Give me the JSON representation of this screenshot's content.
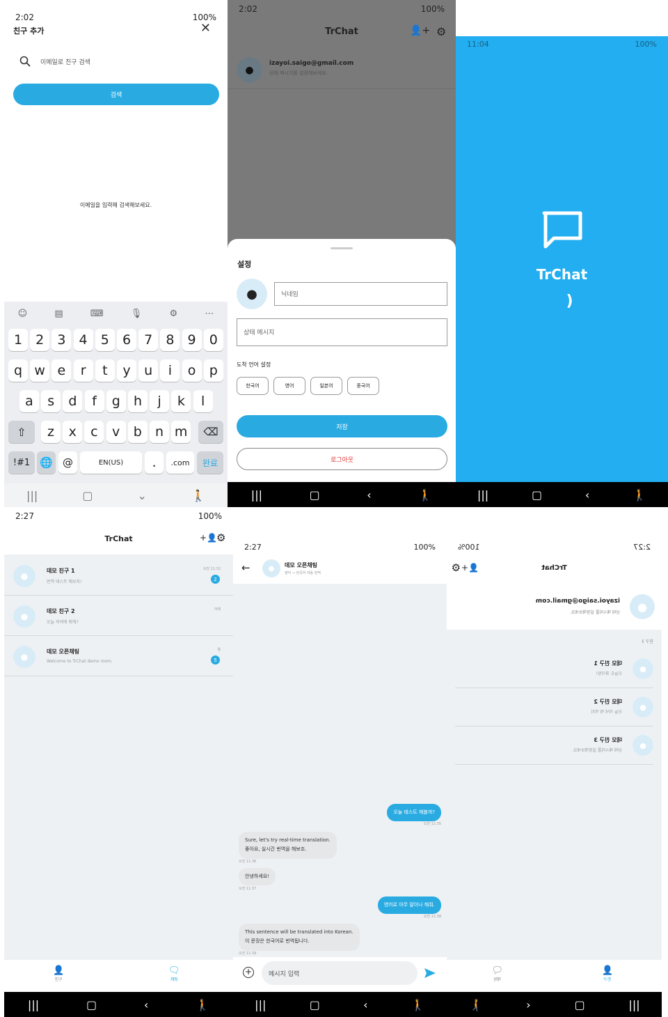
{
  "p1": {
    "time": "2:02",
    "status": "100%",
    "title": "친구 추가",
    "search_placeholder": "이메일로 친구 검색",
    "search_button": "검색",
    "hint": "이메일을 입력해 검색해보세요.",
    "row1": [
      "1",
      "2",
      "3",
      "4",
      "5",
      "6",
      "7",
      "8",
      "9",
      "0"
    ],
    "row2": [
      "q",
      "w",
      "e",
      "r",
      "t",
      "y",
      "u",
      "i",
      "o",
      "p"
    ],
    "row3": [
      "a",
      "s",
      "d",
      "f",
      "g",
      "h",
      "j",
      "k",
      "l"
    ],
    "row4": [
      "z",
      "x",
      "c",
      "v",
      "b",
      "n",
      "m"
    ],
    "sym": "!#1",
    "at": "@",
    "lang": "EN(US)",
    "dot": ".",
    "com": ".com",
    "done": "완료"
  },
  "p2": {
    "time": "2:02",
    "status": "100%",
    "app_title": "TrChat",
    "email": "izayoi.saigo@gmail.com",
    "status_msg": "상태 메시지를 설정해보세요.",
    "sheet_title": "설정",
    "nickname_placeholder": "닉네임",
    "status_placeholder": "상태 메시지",
    "lang_label": "도착 언어 설정",
    "langs": [
      "한국어",
      "영어",
      "일본어",
      "중국어"
    ],
    "save": "저장",
    "logout": "로그아웃"
  },
  "p3": {
    "time": "11:04",
    "status": "100%",
    "app_name": "TrChat",
    "loader": ")"
  },
  "p4": {
    "time": "2:27",
    "status": "100%",
    "app_title": "TrChat",
    "rooms": [
      {
        "name": "데모 친구 1",
        "preview": "번역 테스트 해보자!",
        "time": "오전 11:32",
        "badge": "2"
      },
      {
        "name": "데모 친구 2",
        "preview": "오늘 저녁에 뭐해?",
        "time": "어제",
        "badge": ""
      },
      {
        "name": "데모 오픈채팅",
        "preview": "Welcome to TrChat demo room.",
        "time": "월",
        "badge": "5"
      }
    ],
    "tab_friends": "친구",
    "tab_chat": "채팅"
  },
  "p5": {
    "time": "2:27",
    "status": "100%",
    "room_title": "데모 오픈채팅",
    "room_sub": "영어 → 한국어 자동 번역",
    "input_placeholder": "메시지 입력",
    "m1": "오늘 테스트 해볼까?",
    "m1_time": "오전 11:35",
    "m2_a": "Sure, let's try real-time translation.",
    "m2_b": "좋아요, 실시간 번역을 해보죠.",
    "m2_time": "오전 11:36",
    "m3": "안녕하세요!",
    "m3_time": "오전 11:37",
    "m4": "영어로 아무 말이나 해줘.",
    "m4_time": "오전 11:38",
    "m5_a": "This sentence will be translated into Korean.",
    "m5_b": "이 문장은 한국어로 번역됩니다.",
    "m5_time": "오전 11:39"
  },
  "p6": {
    "time": "2:27",
    "status": "100%",
    "app_title": "TrChat",
    "email": "izayoi.saigo@gmail.com",
    "status_msg": "상태 메시지를 설정해보세요.",
    "section": "친구 3",
    "friends": [
      {
        "name": "데모 친구 1",
        "status": "오늘도 화이팅!"
      },
      {
        "name": "데모 친구 2",
        "status": "오늘 저녁 뭐 먹지"
      },
      {
        "name": "데모 친구 3",
        "status": "상태 메시지를 설정해보세요."
      }
    ],
    "tab_friends": "친구",
    "tab_chat": "채팅"
  }
}
